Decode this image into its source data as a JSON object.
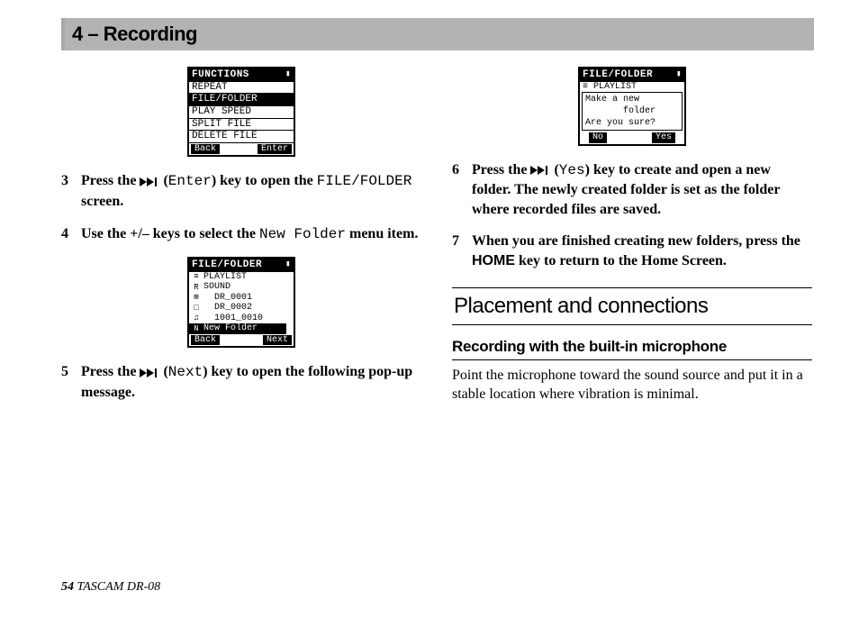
{
  "header": {
    "title": "4 – Recording"
  },
  "lcd1": {
    "title": "FUNCTIONS",
    "rows": [
      "REPEAT",
      "FILE/FOLDER",
      "PLAY SPEED",
      "SPLIT FILE",
      "DELETE FILE"
    ],
    "selected_index": 1,
    "footer_left": "Back",
    "footer_right": "Enter"
  },
  "lcd2": {
    "title": "FILE/FOLDER",
    "items": [
      {
        "icon": "≡",
        "label": "PLAYLIST"
      },
      {
        "icon": "R",
        "label": "SOUND"
      },
      {
        "icon": "⊞",
        "label": "DR_0001"
      },
      {
        "icon": "□",
        "label": "DR_0002"
      },
      {
        "icon": "♫",
        "label": "1001_0010"
      },
      {
        "icon": "N",
        "label": "New Folder"
      }
    ],
    "selected_index": 5,
    "footer_left": "Back",
    "footer_right": "Next"
  },
  "lcd3": {
    "title": "FILE/FOLDER",
    "header_row": {
      "icon": "≡",
      "label": "PLAYLIST"
    },
    "message_lines": [
      "Make a new",
      "       folder",
      "Are you sure?"
    ],
    "footer_left": "No",
    "footer_right": "Yes"
  },
  "steps_left": {
    "s3_a": "Press the ",
    "s3_b": " (",
    "s3_key": "Enter",
    "s3_c": ") key to open the ",
    "s3_screen": "FILE/FOLDER",
    "s3_d": " screen.",
    "s4_a": "Use the +/– keys to select the ",
    "s4_item": "New Folder",
    "s4_b": " menu item.",
    "s5_a": "Press the ",
    "s5_b": " (",
    "s5_key": "Next",
    "s5_c": ") key to open the following pop-up message."
  },
  "steps_right": {
    "s6_a": "Press the ",
    "s6_b": " (",
    "s6_key": "Yes",
    "s6_c": ") key to create and open a new folder. The newly created folder is set as the folder where recorded files are saved.",
    "s7_a": "When you are finished creating new folders, press the ",
    "s7_key": "HOME",
    "s7_b": " key to return to the Home Screen."
  },
  "section": {
    "heading": "Placement and connections"
  },
  "subsection": {
    "heading": "Recording with the built-in microphone",
    "body": "Point the microphone toward the sound source and put it in a stable location where vibration is minimal."
  },
  "footer": {
    "page": "54",
    "product": "TASCAM  DR-08"
  }
}
